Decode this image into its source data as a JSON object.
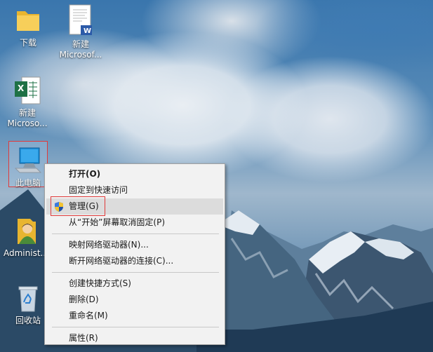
{
  "desktop": {
    "icons": [
      {
        "label": "下载",
        "icon": "folder-icon"
      },
      {
        "label": "新建\nMicrosof...",
        "icon": "word-document-icon"
      },
      {
        "label": "新建\nMicroso...",
        "icon": "excel-document-icon"
      },
      {
        "label": "此电脑",
        "icon": "computer-icon"
      },
      {
        "label": "Administ...",
        "icon": "user-folder-icon"
      },
      {
        "label": "回收站",
        "icon": "recycle-bin-icon"
      }
    ],
    "word_badge": "W",
    "excel_badge": "X"
  },
  "context_menu": {
    "items": [
      {
        "label": "打开(O)"
      },
      {
        "label": "固定到快速访问"
      },
      {
        "label": "管理(G)",
        "icon": "uac-shield-icon"
      },
      {
        "label": "从“开始”屏幕取消固定(P)"
      },
      {
        "label": "映射网络驱动器(N)..."
      },
      {
        "label": "断开网络驱动器的连接(C)..."
      },
      {
        "label": "创建快捷方式(S)"
      },
      {
        "label": "删除(D)"
      },
      {
        "label": "重命名(M)"
      },
      {
        "label": "属性(R)"
      }
    ]
  },
  "colors": {
    "highlight_border": "#e03a3a",
    "menu_background": "#f2f2f2",
    "menu_hover": "#dcdcdc"
  }
}
